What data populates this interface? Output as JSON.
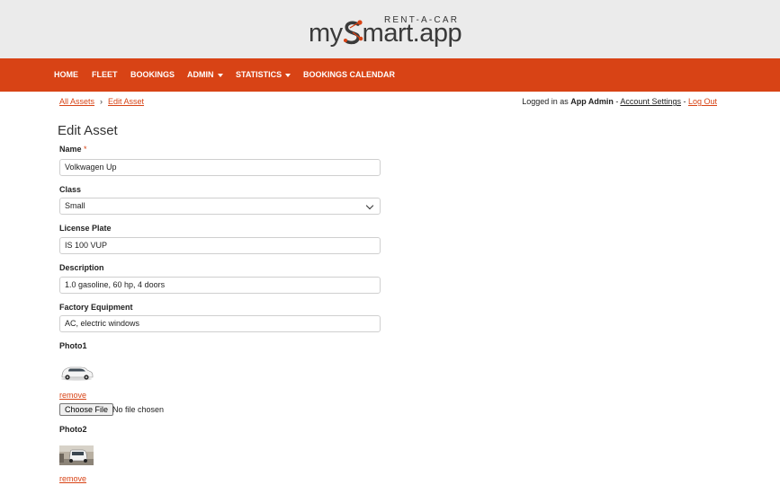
{
  "header": {
    "logo_tagline": "RENT-A-CAR",
    "logo_text_pre": "my",
    "logo_text_post": "mart.app"
  },
  "nav": {
    "items": [
      {
        "label": "HOME",
        "dropdown": false
      },
      {
        "label": "FLEET",
        "dropdown": false
      },
      {
        "label": "BOOKINGS",
        "dropdown": false
      },
      {
        "label": "ADMIN",
        "dropdown": true
      },
      {
        "label": "STATISTICS",
        "dropdown": true
      },
      {
        "label": "BOOKINGS CALENDAR",
        "dropdown": false
      }
    ],
    "color": "#d84315"
  },
  "breadcrumb": {
    "items": [
      "All Assets",
      "Edit Asset"
    ],
    "separator": "›"
  },
  "user": {
    "prefix": "Logged in as ",
    "name": "App Admin",
    "sep1": " - ",
    "account_settings": "Account Settings",
    "sep2": " - ",
    "logout": "Log Out"
  },
  "page": {
    "title": "Edit Asset"
  },
  "form": {
    "name": {
      "label": "Name",
      "required_mark": "*",
      "value": "Volkwagen Up"
    },
    "class": {
      "label": "Class",
      "value": "Small"
    },
    "license_plate": {
      "label": "License Plate",
      "value": "IS 100 VUP"
    },
    "description": {
      "label": "Description",
      "value": "1.0 gasoline, 60 hp, 4 doors"
    },
    "factory_equipment": {
      "label": "Factory Equipment",
      "value": "AC, electric windows"
    },
    "photo1": {
      "label": "Photo1",
      "remove": "remove",
      "choose_file": "Choose File",
      "file_status": "No file chosen"
    },
    "photo2": {
      "label": "Photo2",
      "remove": "remove"
    }
  }
}
